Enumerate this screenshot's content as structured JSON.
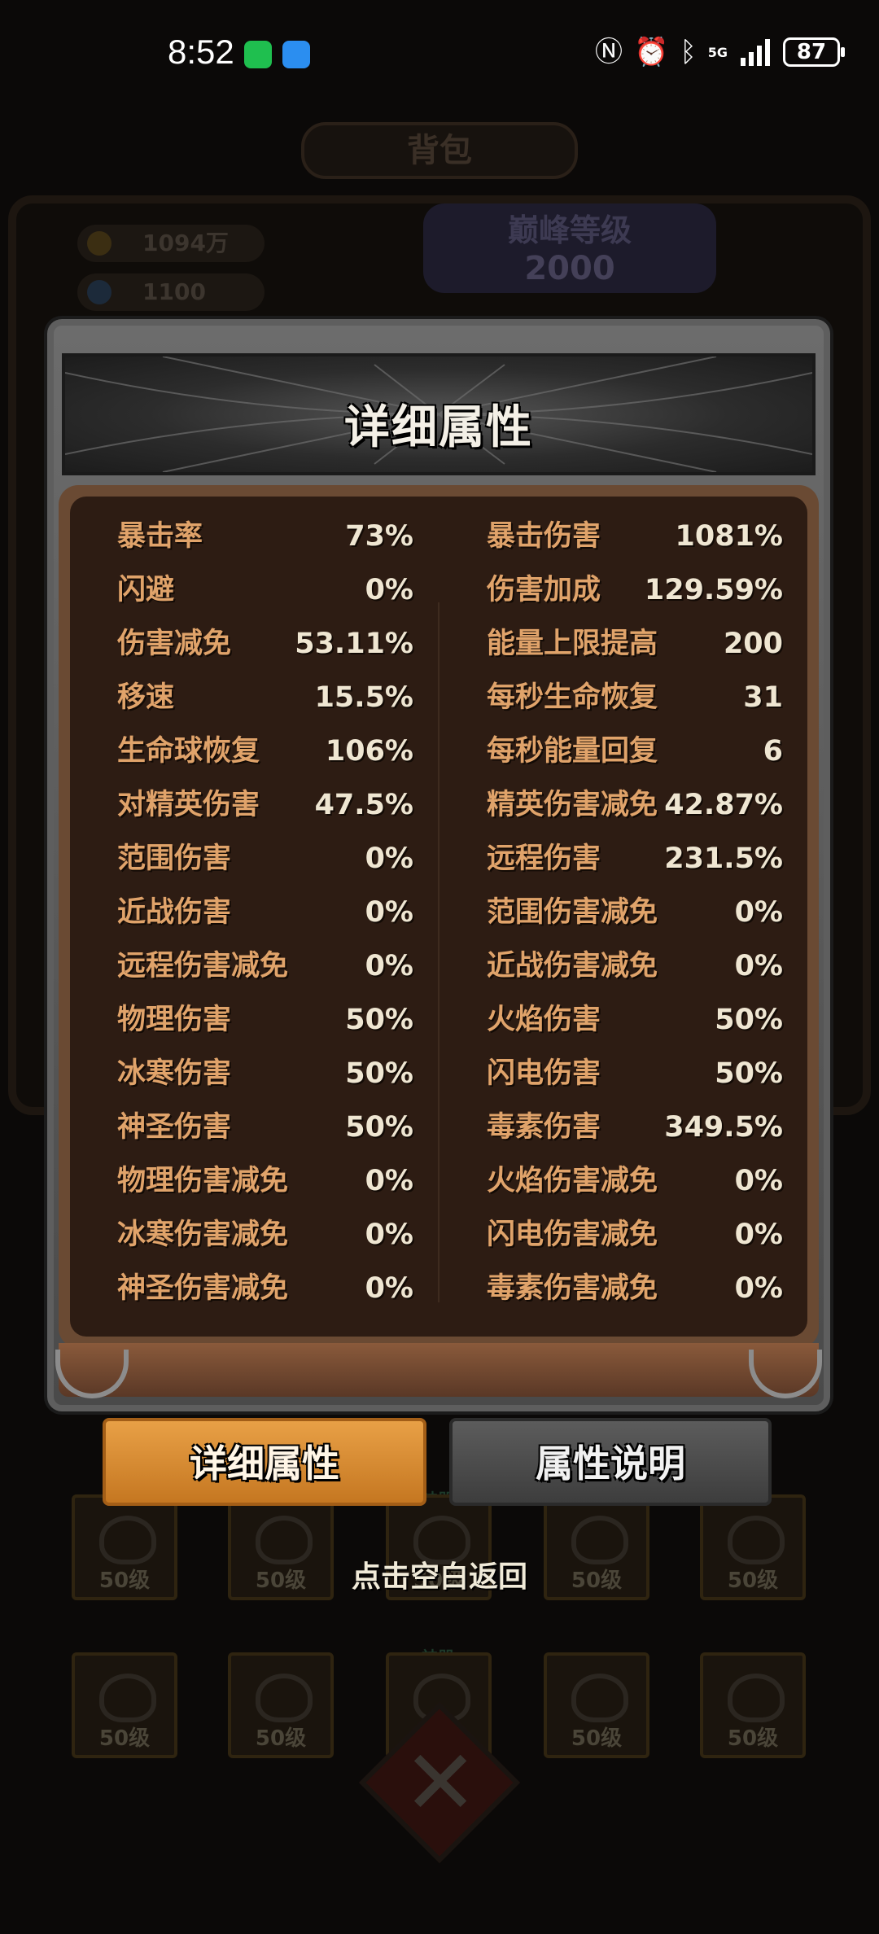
{
  "status_bar": {
    "time": "8:52",
    "network": "5G",
    "battery": "87",
    "icons": [
      "wechat-icon",
      "message-icon",
      "nfc-icon",
      "alarm-icon",
      "bluetooth-icon",
      "signal-icon"
    ]
  },
  "background": {
    "screen_title": "背包",
    "gold": "1094万",
    "gems": "1100",
    "level_label": "巅峰等级",
    "level_value": "2000",
    "slot_level": "50级",
    "group_label_1": "神器",
    "group_label_2": "神器"
  },
  "modal": {
    "title": "详细属性",
    "stats_left": [
      {
        "name": "暴击率",
        "value": "73%"
      },
      {
        "name": "闪避",
        "value": "0%"
      },
      {
        "name": "伤害减免",
        "value": "53.11%"
      },
      {
        "name": "移速",
        "value": "15.5%"
      },
      {
        "name": "生命球恢复",
        "value": "106%"
      },
      {
        "name": "对精英伤害",
        "value": "47.5%"
      },
      {
        "name": "范围伤害",
        "value": "0%"
      },
      {
        "name": "近战伤害",
        "value": "0%"
      },
      {
        "name": "远程伤害减免",
        "value": "0%"
      },
      {
        "name": "物理伤害",
        "value": "50%"
      },
      {
        "name": "冰寒伤害",
        "value": "50%"
      },
      {
        "name": "神圣伤害",
        "value": "50%"
      },
      {
        "name": "物理伤害减免",
        "value": "0%"
      },
      {
        "name": "冰寒伤害减免",
        "value": "0%"
      },
      {
        "name": "神圣伤害减免",
        "value": "0%"
      }
    ],
    "stats_right": [
      {
        "name": "暴击伤害",
        "value": "1081%"
      },
      {
        "name": "伤害加成",
        "value": "129.59%"
      },
      {
        "name": "能量上限提高",
        "value": "200"
      },
      {
        "name": "每秒生命恢复",
        "value": "31"
      },
      {
        "name": "每秒能量回复",
        "value": "6"
      },
      {
        "name": "精英伤害减免",
        "value": "42.87%"
      },
      {
        "name": "远程伤害",
        "value": "231.5%"
      },
      {
        "name": "范围伤害减免",
        "value": "0%"
      },
      {
        "name": "近战伤害减免",
        "value": "0%"
      },
      {
        "name": "火焰伤害",
        "value": "50%"
      },
      {
        "name": "闪电伤害",
        "value": "50%"
      },
      {
        "name": "毒素伤害",
        "value": "349.5%"
      },
      {
        "name": "火焰伤害减免",
        "value": "0%"
      },
      {
        "name": "闪电伤害减免",
        "value": "0%"
      },
      {
        "name": "毒素伤害减免",
        "value": "0%"
      }
    ]
  },
  "tabs": {
    "detail_label": "详细属性",
    "explain_label": "属性说明"
  },
  "hint": "点击空白返回",
  "colors": {
    "stat_name": "#e0a36a",
    "stat_value": "#efe6d2",
    "tab_active": "#d88b30",
    "tab_inactive": "#4a4a4a"
  }
}
